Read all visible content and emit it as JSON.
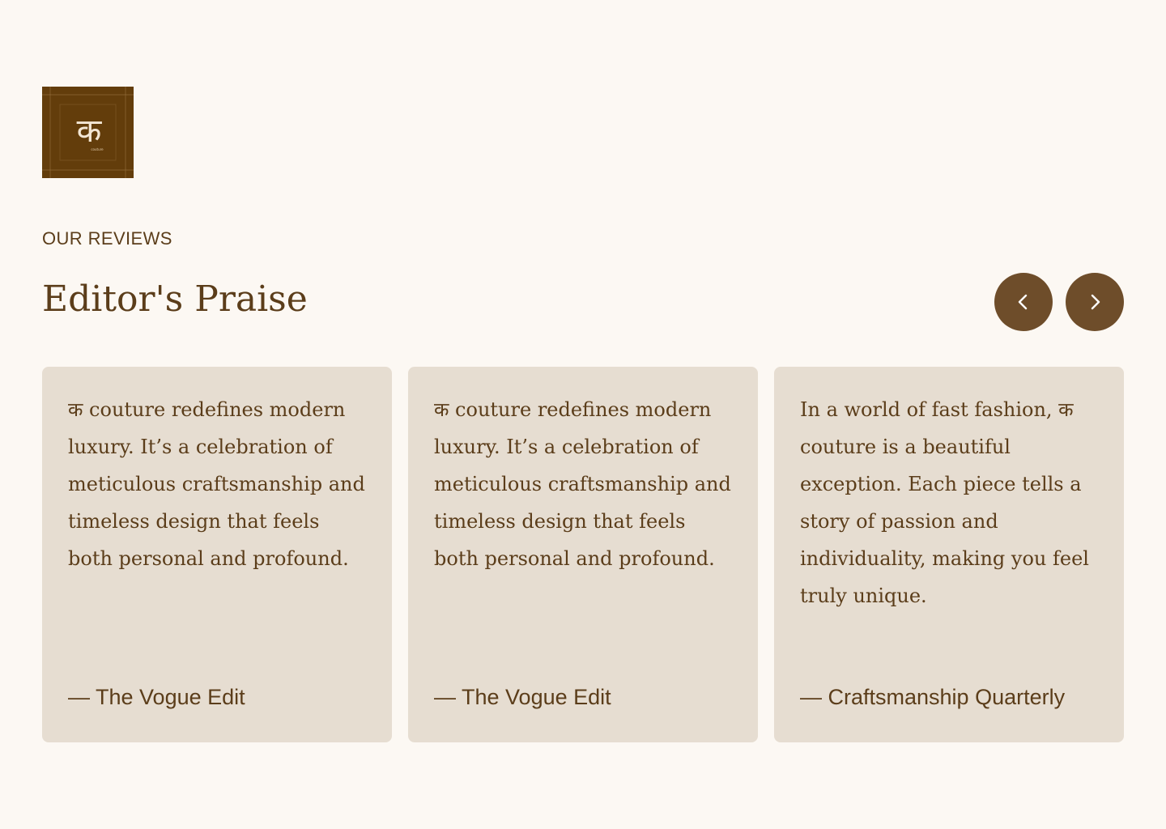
{
  "brand": {
    "logo_glyph": "क",
    "logo_subtext": "couture",
    "logo_color": "#633d0b"
  },
  "header": {
    "eyebrow": "OUR REVIEWS",
    "title": "Editor's Praise"
  },
  "controls": {
    "prev_icon": "chevron-left-icon",
    "next_icon": "chevron-right-icon",
    "button_color": "#6e4d2a"
  },
  "reviews": [
    {
      "quote": "क couture redefines modern luxury. It’s a celebration of meticulous craftsmanship and timeless design that feels both personal and profound.",
      "source": "— The Vogue Edit"
    },
    {
      "quote": "क couture redefines modern luxury. It’s a celebration of meticulous craftsmanship and timeless design that feels both personal and profound.",
      "source": "— The Vogue Edit"
    },
    {
      "quote": "In a world of fast fashion, क couture is a beautiful exception. Each piece tells a story of passion and individuality, making you feel truly unique.",
      "source": "— Craftsmanship Quarterly"
    }
  ],
  "colors": {
    "page_background": "#fcf8f3",
    "card_background": "#e6ddd1",
    "text": "#5b3d1a"
  }
}
